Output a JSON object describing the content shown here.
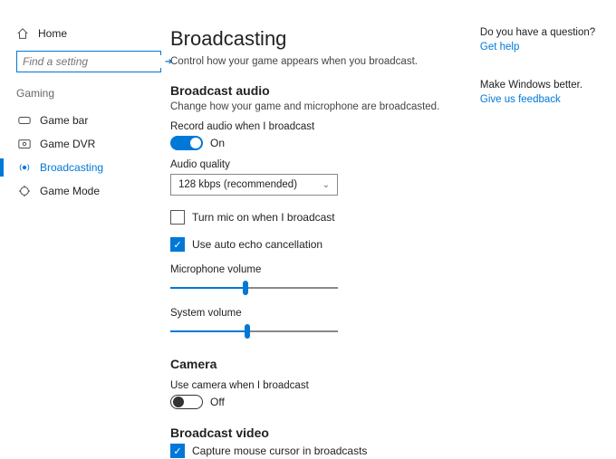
{
  "sidebar": {
    "home": "Home",
    "search_placeholder": "Find a setting",
    "category": "Gaming",
    "items": [
      {
        "label": "Game bar"
      },
      {
        "label": "Game DVR"
      },
      {
        "label": "Broadcasting"
      },
      {
        "label": "Game Mode"
      }
    ]
  },
  "page": {
    "title": "Broadcasting",
    "subtitle": "Control how your game appears when you broadcast."
  },
  "audio": {
    "heading": "Broadcast audio",
    "subdesc": "Change how your game and microphone are broadcasted.",
    "record_label": "Record audio when I broadcast",
    "record_state": "On",
    "quality_label": "Audio quality",
    "quality_value": "128 kbps (recommended)",
    "mic_on_label": "Turn mic on when I broadcast",
    "echo_label": "Use auto echo cancellation",
    "mic_vol_label": "Microphone volume",
    "mic_vol_percent": 45,
    "sys_vol_label": "System volume",
    "sys_vol_percent": 46
  },
  "camera": {
    "heading": "Camera",
    "use_label": "Use camera when I broadcast",
    "use_state": "Off"
  },
  "video": {
    "heading": "Broadcast video",
    "cursor_label": "Capture mouse cursor in broadcasts"
  },
  "right": {
    "question": "Do you have a question?",
    "help": "Get help",
    "better": "Make Windows better.",
    "feedback": "Give us feedback"
  }
}
